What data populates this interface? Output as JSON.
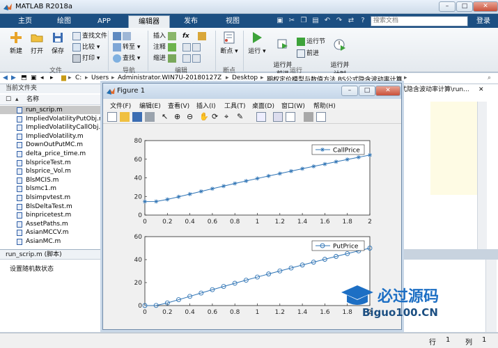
{
  "app": {
    "title": "MATLAB R2018a"
  },
  "tabs": [
    "主页",
    "绘图",
    "APP",
    "编辑器",
    "发布",
    "视图"
  ],
  "search": {
    "placeholder": "搜索文档"
  },
  "login": "登录",
  "ribbon": {
    "new": "新建",
    "open": "打开",
    "save": "保存",
    "find_files": "查找文件",
    "compare": "比较",
    "print": "打印",
    "file_group": "文件",
    "goto": "转至",
    "find": "查找",
    "nav_group": "导航",
    "insert": "插入",
    "comment": "注释",
    "indent": "缩进",
    "fx": "fx",
    "edit_group": "编辑",
    "breakpoints": "断点",
    "bp_group": "断点",
    "run": "运行",
    "run_advance": "运行并\n前进",
    "run_section": "运行节",
    "advance": "前进",
    "run_time": "运行并\n计时",
    "run_group": "运行"
  },
  "address": {
    "path": [
      "C:",
      "Users",
      "Administrator.WIN7U-20180127Z",
      "Desktop",
      "期权定价模型与数值方法 BS公式隐含波动率计算"
    ]
  },
  "left_panel": {
    "header": "当前文件夹",
    "col_name": "名称",
    "files": [
      "run_scrip.m",
      "ImpliedVolatilityPutObj.m",
      "ImpliedVolatilityCallObj.m",
      "ImpliedVolatility.m",
      "DownOutPutMC.m",
      "delta_price_time.m",
      "blspriceTest.m",
      "blsprice_Vol.m",
      "BlsMCIS.m",
      "blsmc1.m",
      "blsimpvtest.m",
      "BlsDeltaTest.m",
      "binpricetest.m",
      "AssetPaths.m",
      "AsianMCCV.m",
      "AsianMC.m"
    ],
    "selected": 0
  },
  "details": {
    "header": "run_scrip.m  (脚本)",
    "text": "设置随机数状态"
  },
  "editor": {
    "tab": "式隐含波动率计算\\run..."
  },
  "status": {
    "row_label": "行",
    "row": "1",
    "col_label": "列",
    "col": "1"
  },
  "figure": {
    "title": "Figure 1",
    "menu": [
      "文件(F)",
      "编辑(E)",
      "查看(V)",
      "插入(I)",
      "工具(T)",
      "桌面(D)",
      "窗口(W)",
      "帮助(H)"
    ]
  },
  "watermark": {
    "line1": "必过源码",
    "line2": "Biguo100.CN"
  },
  "colors": {
    "series": "#2f74b5",
    "accent": "#1c4f82"
  },
  "chart_data": [
    {
      "type": "line",
      "legend": [
        "CallPrice"
      ],
      "legend_position": "top-right",
      "marker": "star",
      "x": [
        0,
        0.1,
        0.2,
        0.3,
        0.4,
        0.5,
        0.6,
        0.7,
        0.8,
        0.9,
        1.0,
        1.1,
        1.2,
        1.3,
        1.4,
        1.5,
        1.6,
        1.7,
        1.8,
        1.9,
        2.0
      ],
      "series": [
        {
          "name": "CallPrice",
          "values": [
            14.5,
            14.6,
            16.8,
            19.6,
            22.5,
            25.4,
            28.3,
            31.1,
            33.9,
            36.6,
            39.3,
            42.0,
            44.6,
            47.2,
            49.8,
            52.3,
            54.8,
            57.3,
            59.7,
            62.1,
            64.5
          ]
        }
      ],
      "xlim": [
        0,
        2
      ],
      "ylim": [
        0,
        80
      ],
      "xticks": [
        0,
        0.2,
        0.4,
        0.6,
        0.8,
        1,
        1.2,
        1.4,
        1.6,
        1.8,
        2
      ],
      "yticks": [
        0,
        20,
        40,
        60,
        80
      ]
    },
    {
      "type": "line",
      "legend": [
        "PutPrice"
      ],
      "legend_position": "top-right",
      "marker": "circle",
      "x": [
        0,
        0.1,
        0.2,
        0.3,
        0.4,
        0.5,
        0.6,
        0.7,
        0.8,
        0.9,
        1.0,
        1.1,
        1.2,
        1.3,
        1.4,
        1.5,
        1.6,
        1.7,
        1.8,
        1.9,
        2.0
      ],
      "series": [
        {
          "name": "PutPrice",
          "values": [
            0,
            0.1,
            2.3,
            5.1,
            8.0,
            10.9,
            13.8,
            16.6,
            19.4,
            22.1,
            24.8,
            27.5,
            30.1,
            32.7,
            35.3,
            37.8,
            40.3,
            42.8,
            45.2,
            47.6,
            50.0
          ]
        }
      ],
      "xlim": [
        0,
        2
      ],
      "ylim": [
        0,
        60
      ],
      "xticks": [
        0,
        0.2,
        0.4,
        0.6,
        0.8,
        1,
        1.2,
        1.4,
        1.6,
        1.8,
        2
      ],
      "yticks": [
        0,
        20,
        40,
        60
      ]
    }
  ]
}
